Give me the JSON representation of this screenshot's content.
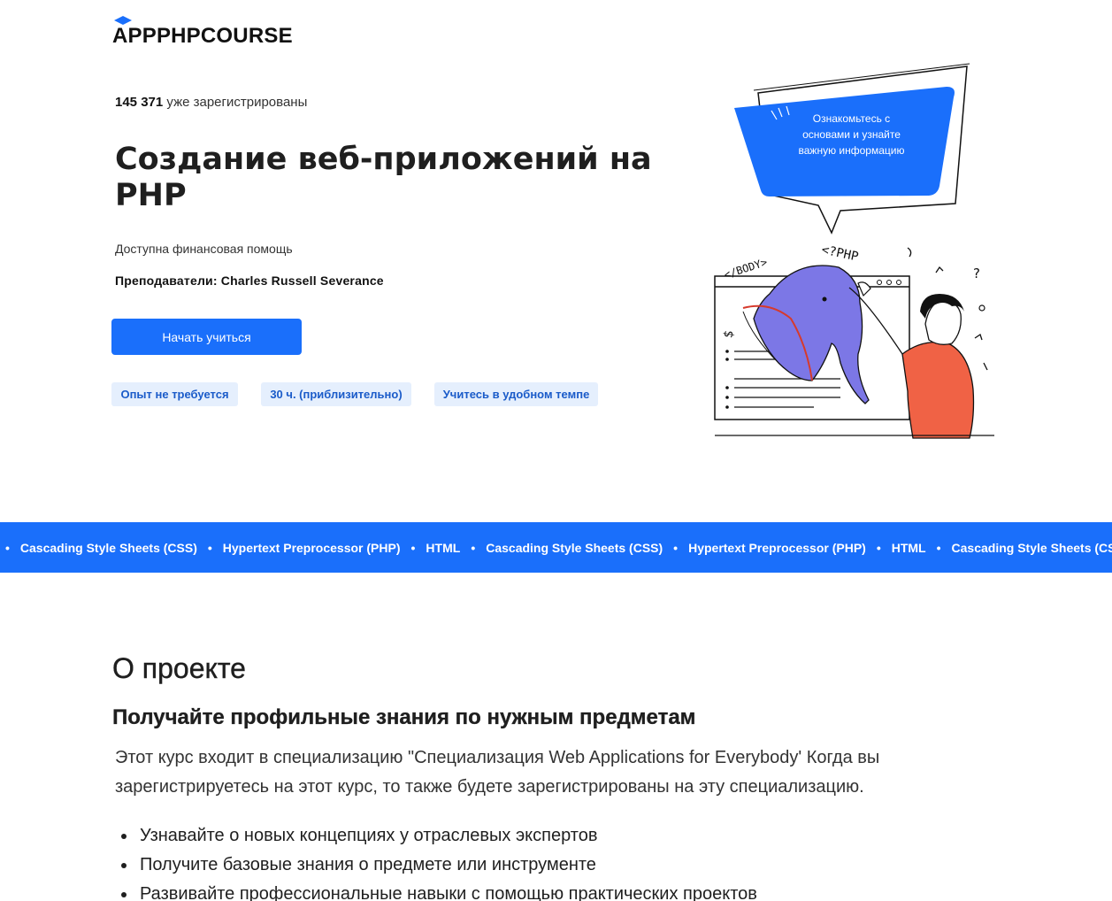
{
  "brand": {
    "name": "APPPHPCOURSE",
    "icon": "graduation-cap-icon",
    "accent": "#1a6ffb"
  },
  "hero": {
    "registered_count": "145 371",
    "registered_text": "уже зарегистрированы",
    "title": "Создание веб-приложений на PHP",
    "financial_aid": "Доступна финансовая помощь",
    "instructors": "Преподаватели: Charles Russell Severance",
    "cta_label": "Начать учиться",
    "tags": [
      "Опыт не требуется",
      "30 ч. (приблизительно)",
      "Учитесь в удобном темпе"
    ]
  },
  "illustration": {
    "bubble_text": "Ознакомьтесь с основами и узнайте важную информацию",
    "labels": {
      "body_tag": "</BODY>",
      "php_tag": "<?PHP",
      "question": "?",
      "dollar": "$"
    }
  },
  "ticker": {
    "items": [
      "Cascading Style Sheets (CSS)",
      "Hypertext Preprocessor (PHP)",
      "HTML",
      "Cascading Style Sheets (CSS)",
      "Hypertext Preprocessor (PHP)",
      "HTML",
      "Cascading Style Sheets (CSS)"
    ]
  },
  "about": {
    "title": "О проекте",
    "subtitle": "Получайте профильные знания по нужным предметам",
    "description": "Этот курс входит в специализацию \"Специализация Web Applications for Everybody' Когда вы зарегистрируетесь на этот курс, то также будете зарегистрированы на эту специализацию.",
    "bullets": [
      "Узнавайте о новых концепциях у отраслевых экспертов",
      "Получите базовые знания о предмете или инструменте",
      "Развивайте профессиональные навыки с помощью практических проектов"
    ]
  }
}
